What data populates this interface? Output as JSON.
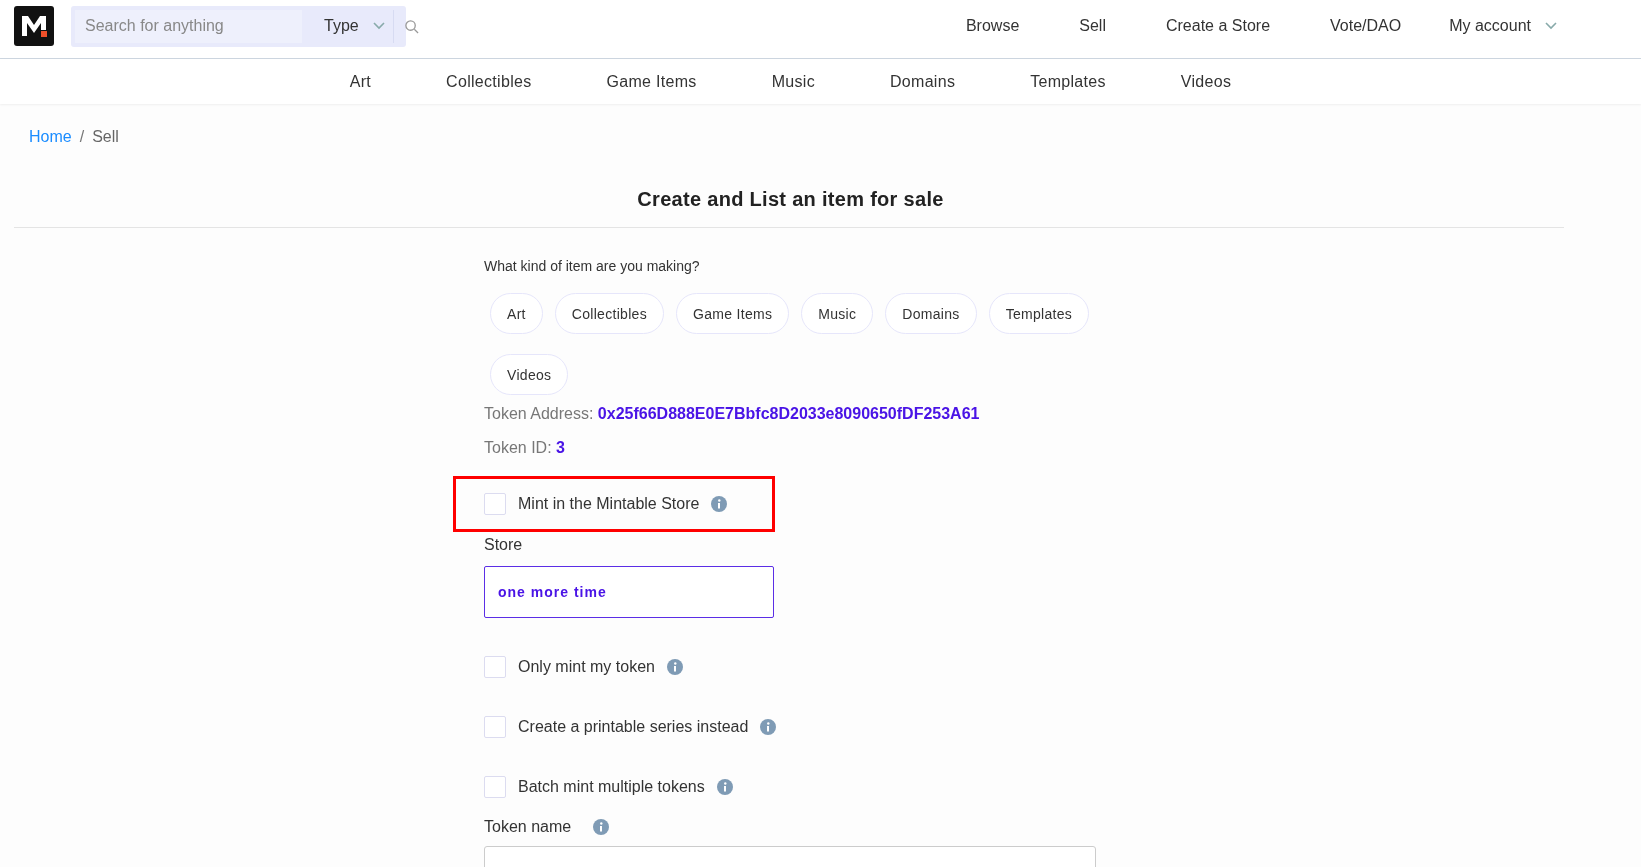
{
  "header": {
    "search": {
      "placeholder": "Search for anything"
    },
    "type_select": {
      "value": "Type"
    },
    "nav": [
      "Browse",
      "Sell",
      "Create a Store",
      "Vote/DAO"
    ],
    "account": "My account"
  },
  "categories": [
    "Art",
    "Collectibles",
    "Game Items",
    "Music",
    "Domains",
    "Templates",
    "Videos"
  ],
  "breadcrumb_separator": "/",
  "breadcrumb": [
    {
      "label": "Home",
      "kind": "link"
    },
    {
      "label": "Sell",
      "kind": "current"
    }
  ],
  "page_title": "Create and List an item for sale",
  "form": {
    "question": "What kind of item are you making?",
    "item_types": [
      {
        "label": "Art",
        "selected": false
      },
      {
        "label": "Collectibles",
        "selected": false
      },
      {
        "label": "Game Items",
        "selected": false
      },
      {
        "label": "Music",
        "selected": false
      },
      {
        "label": "Domains",
        "selected": false
      },
      {
        "label": "Templates",
        "selected": false
      },
      {
        "label": "Videos",
        "selected": false
      }
    ],
    "token_address": {
      "label": "Token Address:",
      "value": "0x25f66D888E0E7Bbfc8D2033e8090650fDF253A61"
    },
    "token_id": {
      "label": "Token ID:",
      "value": "3"
    },
    "mint_in_store": {
      "label": "Mint in the Mintable Store",
      "checked": false,
      "highlighted": true
    },
    "store": {
      "label": "Store",
      "value": "one more time"
    },
    "options": [
      {
        "label": "Only mint my token",
        "checked": false
      },
      {
        "label": "Create a printable series instead",
        "checked": false
      },
      {
        "label": "Batch mint multiple tokens",
        "checked": false
      }
    ],
    "token_name": {
      "label": "Token name"
    }
  }
}
